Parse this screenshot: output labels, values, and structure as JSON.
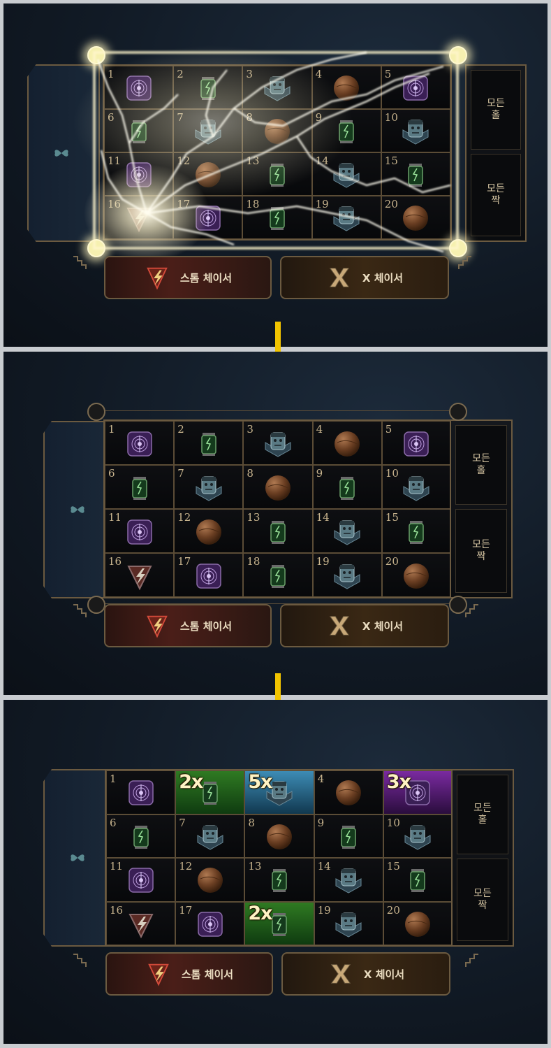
{
  "board_labels": {
    "all_odd": "모든\n홀",
    "all_even": "모든\n짝",
    "storm_chaser": "스톰 체이서",
    "x_chaser": "X 체이서"
  },
  "colors": {
    "gold_border": "#6b5a40",
    "arrow_yellow": "#f2c400",
    "highlight_green": "#2f7a22",
    "highlight_blue": "#3d8cb5",
    "highlight_purple": "#7a2aa0"
  },
  "panels": [
    {
      "id": "lightning-strike",
      "lightning": true,
      "cells": [
        {
          "n": "1",
          "icon": "purple-orb-icon"
        },
        {
          "n": "2",
          "icon": "green-jar-icon"
        },
        {
          "n": "3",
          "icon": "monster-head-icon"
        },
        {
          "n": "4",
          "icon": "bronze-ball-icon"
        },
        {
          "n": "5",
          "icon": "purple-orb-icon"
        },
        {
          "n": "6",
          "icon": "green-jar-icon"
        },
        {
          "n": "7",
          "icon": "monster-head-icon"
        },
        {
          "n": "8",
          "icon": "bronze-ball-icon"
        },
        {
          "n": "9",
          "icon": "green-jar-icon"
        },
        {
          "n": "10",
          "icon": "monster-head-icon"
        },
        {
          "n": "11",
          "icon": "purple-orb-icon"
        },
        {
          "n": "12",
          "icon": "bronze-ball-icon"
        },
        {
          "n": "13",
          "icon": "green-jar-icon"
        },
        {
          "n": "14",
          "icon": "monster-head-icon"
        },
        {
          "n": "15",
          "icon": "green-jar-icon"
        },
        {
          "n": "16",
          "icon": "storm-bolt-icon"
        },
        {
          "n": "17",
          "icon": "purple-orb-icon"
        },
        {
          "n": "18",
          "icon": "green-jar-icon"
        },
        {
          "n": "19",
          "icon": "monster-head-icon"
        },
        {
          "n": "20",
          "icon": "bronze-ball-icon"
        }
      ]
    },
    {
      "id": "plain-board",
      "lightning": false,
      "cells": [
        {
          "n": "1",
          "icon": "purple-orb-icon"
        },
        {
          "n": "2",
          "icon": "green-jar-icon"
        },
        {
          "n": "3",
          "icon": "monster-head-icon"
        },
        {
          "n": "4",
          "icon": "bronze-ball-icon"
        },
        {
          "n": "5",
          "icon": "purple-orb-icon"
        },
        {
          "n": "6",
          "icon": "green-jar-icon"
        },
        {
          "n": "7",
          "icon": "monster-head-icon"
        },
        {
          "n": "8",
          "icon": "bronze-ball-icon"
        },
        {
          "n": "9",
          "icon": "green-jar-icon"
        },
        {
          "n": "10",
          "icon": "monster-head-icon"
        },
        {
          "n": "11",
          "icon": "purple-orb-icon"
        },
        {
          "n": "12",
          "icon": "bronze-ball-icon"
        },
        {
          "n": "13",
          "icon": "green-jar-icon"
        },
        {
          "n": "14",
          "icon": "monster-head-icon"
        },
        {
          "n": "15",
          "icon": "green-jar-icon"
        },
        {
          "n": "16",
          "icon": "storm-bolt-icon"
        },
        {
          "n": "17",
          "icon": "purple-orb-icon"
        },
        {
          "n": "18",
          "icon": "green-jar-icon"
        },
        {
          "n": "19",
          "icon": "monster-head-icon"
        },
        {
          "n": "20",
          "icon": "bronze-ball-icon"
        }
      ]
    },
    {
      "id": "multiplier-board",
      "lightning": false,
      "cells": [
        {
          "n": "1",
          "icon": "purple-orb-icon"
        },
        {
          "mult": "2x",
          "hl": "green",
          "icon": "green-jar-icon"
        },
        {
          "mult": "5x",
          "hl": "blue",
          "icon": "monster-head-icon"
        },
        {
          "n": "4",
          "icon": "bronze-ball-icon"
        },
        {
          "mult": "3x",
          "hl": "purple",
          "icon": "purple-orb-icon"
        },
        {
          "n": "6",
          "icon": "green-jar-icon"
        },
        {
          "n": "7",
          "icon": "monster-head-icon"
        },
        {
          "n": "8",
          "icon": "bronze-ball-icon"
        },
        {
          "n": "9",
          "icon": "green-jar-icon"
        },
        {
          "n": "10",
          "icon": "monster-head-icon"
        },
        {
          "n": "11",
          "icon": "purple-orb-icon"
        },
        {
          "n": "12",
          "icon": "bronze-ball-icon"
        },
        {
          "n": "13",
          "icon": "green-jar-icon"
        },
        {
          "n": "14",
          "icon": "monster-head-icon"
        },
        {
          "n": "15",
          "icon": "green-jar-icon"
        },
        {
          "n": "16",
          "icon": "storm-bolt-icon"
        },
        {
          "n": "17",
          "icon": "purple-orb-icon"
        },
        {
          "mult": "2x",
          "hl": "green",
          "icon": "green-jar-icon"
        },
        {
          "n": "19",
          "icon": "monster-head-icon"
        },
        {
          "n": "20",
          "icon": "bronze-ball-icon"
        }
      ]
    }
  ]
}
